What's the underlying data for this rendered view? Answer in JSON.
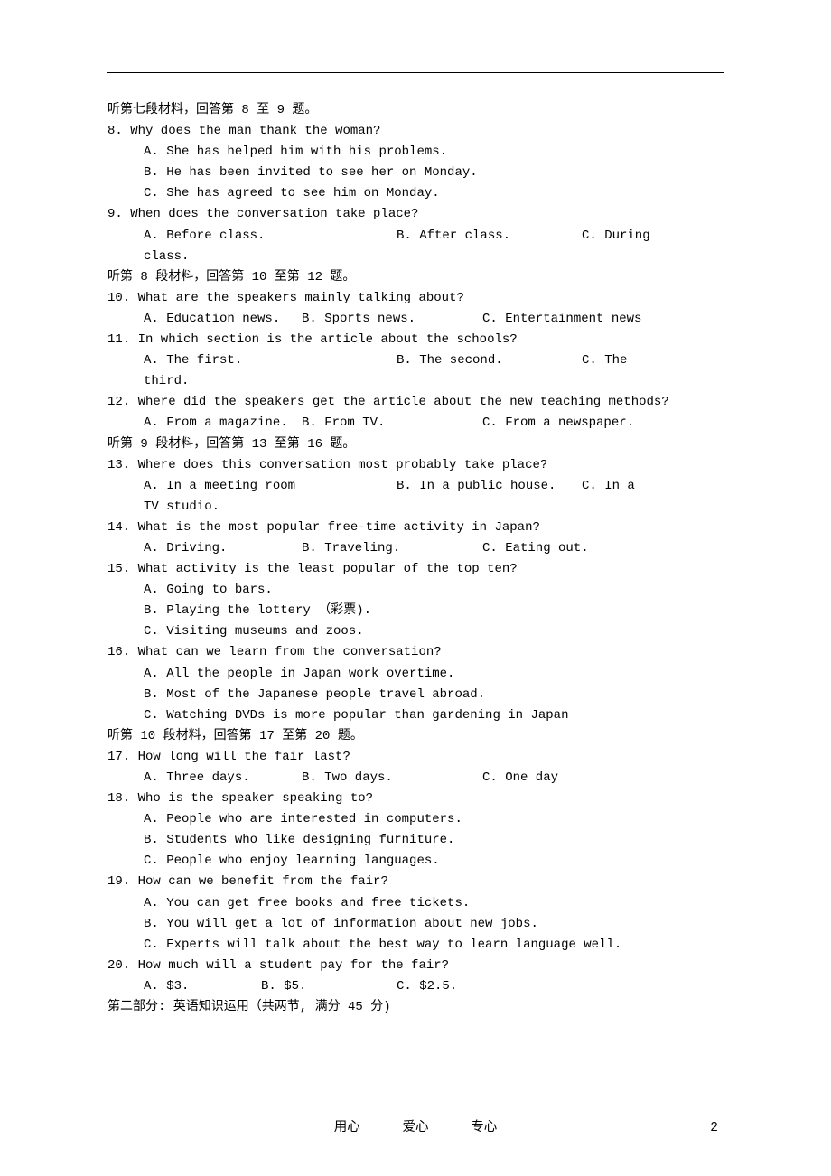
{
  "groups": [
    {
      "header": "听第七段材料，回答第 8 至 9 题。",
      "questions": [
        {
          "text": "8. Why does the man thank the woman?",
          "options": [
            "A. She has helped him with his problems.",
            "B. He has been invited to see her on Monday.",
            "C. She has agreed to see him on Monday."
          ],
          "layout": "stacked"
        },
        {
          "text": "9. When does the conversation take place?",
          "options_a": "A. Before class.",
          "options_b": "B. After class.",
          "options_c": "C. During",
          "wrap": "class.",
          "layout": "inline-wrap"
        }
      ]
    },
    {
      "header": "听第 8 段材料，回答第 10 至第 12 题。",
      "questions": [
        {
          "text": "10. What are the speakers mainly talking about?",
          "options_a": "A. Education news.",
          "options_b": "B. Sports news.",
          "options_c": "C. Entertainment news",
          "layout": "inline"
        },
        {
          "text": "11. In which section is the article about the schools?",
          "options_a": "A. The first.",
          "options_b": "B. The second.",
          "options_c": "C. The",
          "wrap": "third.",
          "layout": "inline-wrap"
        },
        {
          "text": "12. Where did the speakers get the article about the new teaching methods?",
          "options_a": "A. From a magazine.",
          "options_b": "B. From TV.",
          "options_c": "C. From a newspaper.",
          "layout": "inline"
        }
      ]
    },
    {
      "header": "听第 9 段材料，回答第 13 至第 16 题。",
      "questions": [
        {
          "text": "13. Where does this conversation most probably take place?",
          "options_a": "A. In a meeting room",
          "options_b": "B. In a public house.",
          "options_c": "C. In a",
          "wrap": "TV studio.",
          "layout": "inline-wrap-wide"
        },
        {
          "text": "14. What is the most popular free-time activity in Japan?",
          "options_a": "A. Driving.",
          "options_b": "B. Traveling.",
          "options_c": "C. Eating out.",
          "layout": "inline"
        },
        {
          "text": "15. What activity is the least popular of the top ten?",
          "options": [
            "A. Going to bars.",
            "B. Playing the lottery （彩票).",
            "C. Visiting museums and zoos."
          ],
          "layout": "stacked"
        },
        {
          "text": "16. What can we learn from the conversation?",
          "options": [
            "A. All the people in Japan work overtime.",
            "B. Most of the Japanese people travel abroad.",
            "C. Watching DVDs is more popular than gardening in Japan"
          ],
          "layout": "stacked"
        }
      ]
    },
    {
      "header": "听第 10 段材料，回答第 17 至第 20 题。",
      "questions": [
        {
          "text": "17. How long will the fair last?",
          "options_a": "A. Three days.",
          "options_b": "B. Two days.",
          "options_c": "C. One day",
          "layout": "inline"
        },
        {
          "text": "18. Who is the speaker speaking to?",
          "options": [
            "A. People who are interested in computers.",
            "B. Students who like designing furniture.",
            "C. People who enjoy learning languages."
          ],
          "layout": "stacked"
        },
        {
          "text": "19. How can we benefit from the fair?",
          "options": [
            "A. You can get free books and free tickets.",
            "B. You will get a lot of information about new jobs.",
            "C. Experts will talk about the best way to learn language well."
          ],
          "layout": "stacked"
        },
        {
          "text": "20. How much will a student pay for the fair?",
          "options_a": "A. $3.",
          "options_b": "B. $5.",
          "options_c": "C. $2.5.",
          "layout": "inline-tight"
        }
      ]
    }
  ],
  "section_header": "第二部分: 英语知识运用（共两节, 满分 45 分)",
  "footer": {
    "w1": "用心",
    "w2": "爱心",
    "w3": "专心"
  },
  "page_number": "2"
}
